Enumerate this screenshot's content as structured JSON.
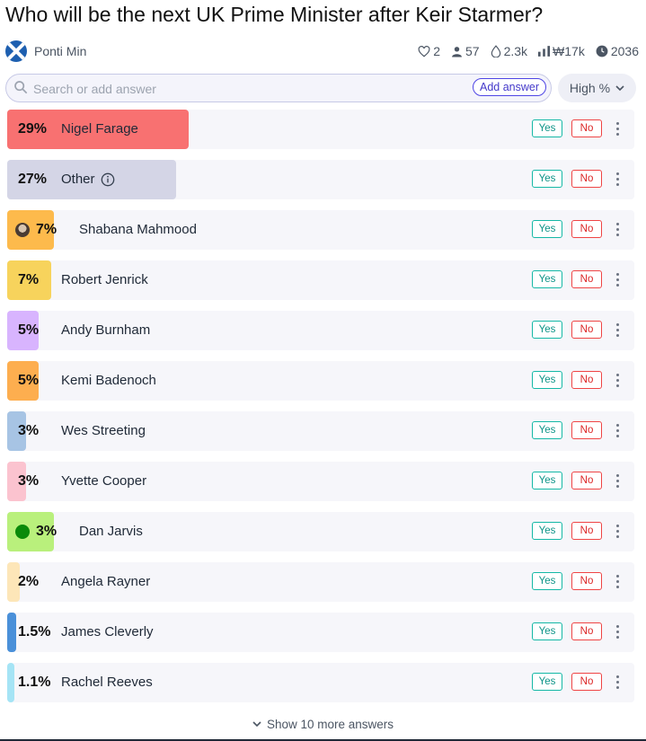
{
  "question": {
    "title": "Who will be the next UK Prime Minister after Keir Starmer?"
  },
  "author": {
    "name": "Ponti Min",
    "avatar_icon": "scotland-flag-icon"
  },
  "stats": {
    "likes": "2",
    "traders": "57",
    "liquidity": "2.3k",
    "volume": "₩17k",
    "close_date": "2036"
  },
  "search": {
    "placeholder": "Search or add answer",
    "add_label": "Add answer"
  },
  "sort": {
    "label": "High %"
  },
  "answers": [
    {
      "pct": "29%",
      "value": 29,
      "name": "Nigel Farage",
      "color": "#f87171"
    },
    {
      "pct": "27%",
      "value": 27,
      "name": "Other",
      "color": "#d4d5e6",
      "info_icon": true
    },
    {
      "pct": "7%",
      "value": 7,
      "name": "Shabana Mahmood",
      "color": "#fdba4c",
      "avatar": "photo"
    },
    {
      "pct": "7%",
      "value": 7,
      "name": "Robert Jenrick",
      "color": "#f7d35c"
    },
    {
      "pct": "5%",
      "value": 5,
      "name": "Andy Burnham",
      "color": "#d8b4fe"
    },
    {
      "pct": "5%",
      "value": 5,
      "name": "Kemi Badenoch",
      "color": "#fdae4f"
    },
    {
      "pct": "3%",
      "value": 3,
      "name": "Wes Streeting",
      "color": "#a7c4e4"
    },
    {
      "pct": "3%",
      "value": 3,
      "name": "Yvette Cooper",
      "color": "#fbc3cf"
    },
    {
      "pct": "3%",
      "value": 3,
      "name": "Dan Jarvis",
      "color": "#b9f07c",
      "avatar": "green-dot"
    },
    {
      "pct": "2%",
      "value": 2,
      "name": "Angela Rayner",
      "color": "#fde6b8"
    },
    {
      "pct": "1.5%",
      "value": 1.5,
      "name": "James Cleverly",
      "color": "#4a90d9"
    },
    {
      "pct": "1.1%",
      "value": 1.1,
      "name": "Rachel Reeves",
      "color": "#a5e4f5"
    }
  ],
  "buttons": {
    "yes": "Yes",
    "no": "No"
  },
  "footer": {
    "show_more": "Show 10 more answers"
  }
}
